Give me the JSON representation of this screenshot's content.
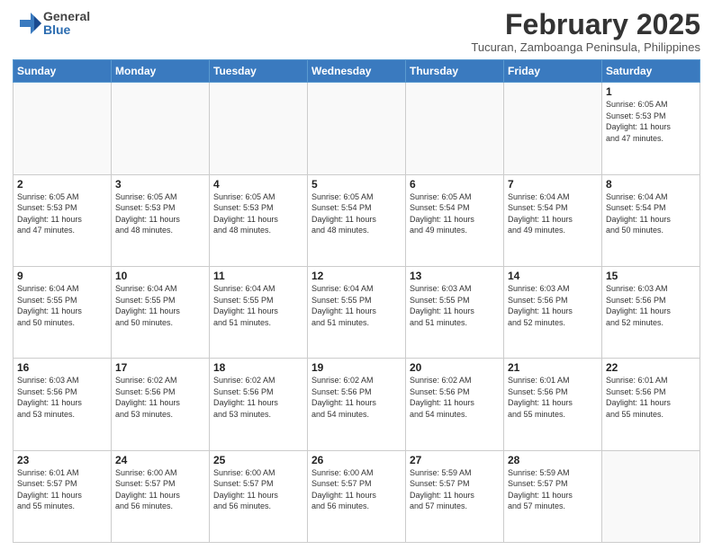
{
  "header": {
    "logo_general": "General",
    "logo_blue": "Blue",
    "month_title": "February 2025",
    "subtitle": "Tucuran, Zamboanga Peninsula, Philippines"
  },
  "weekdays": [
    "Sunday",
    "Monday",
    "Tuesday",
    "Wednesday",
    "Thursday",
    "Friday",
    "Saturday"
  ],
  "weeks": [
    [
      {
        "day": "",
        "info": ""
      },
      {
        "day": "",
        "info": ""
      },
      {
        "day": "",
        "info": ""
      },
      {
        "day": "",
        "info": ""
      },
      {
        "day": "",
        "info": ""
      },
      {
        "day": "",
        "info": ""
      },
      {
        "day": "1",
        "info": "Sunrise: 6:05 AM\nSunset: 5:53 PM\nDaylight: 11 hours\nand 47 minutes."
      }
    ],
    [
      {
        "day": "2",
        "info": "Sunrise: 6:05 AM\nSunset: 5:53 PM\nDaylight: 11 hours\nand 47 minutes."
      },
      {
        "day": "3",
        "info": "Sunrise: 6:05 AM\nSunset: 5:53 PM\nDaylight: 11 hours\nand 48 minutes."
      },
      {
        "day": "4",
        "info": "Sunrise: 6:05 AM\nSunset: 5:53 PM\nDaylight: 11 hours\nand 48 minutes."
      },
      {
        "day": "5",
        "info": "Sunrise: 6:05 AM\nSunset: 5:54 PM\nDaylight: 11 hours\nand 48 minutes."
      },
      {
        "day": "6",
        "info": "Sunrise: 6:05 AM\nSunset: 5:54 PM\nDaylight: 11 hours\nand 49 minutes."
      },
      {
        "day": "7",
        "info": "Sunrise: 6:04 AM\nSunset: 5:54 PM\nDaylight: 11 hours\nand 49 minutes."
      },
      {
        "day": "8",
        "info": "Sunrise: 6:04 AM\nSunset: 5:54 PM\nDaylight: 11 hours\nand 50 minutes."
      }
    ],
    [
      {
        "day": "9",
        "info": "Sunrise: 6:04 AM\nSunset: 5:55 PM\nDaylight: 11 hours\nand 50 minutes."
      },
      {
        "day": "10",
        "info": "Sunrise: 6:04 AM\nSunset: 5:55 PM\nDaylight: 11 hours\nand 50 minutes."
      },
      {
        "day": "11",
        "info": "Sunrise: 6:04 AM\nSunset: 5:55 PM\nDaylight: 11 hours\nand 51 minutes."
      },
      {
        "day": "12",
        "info": "Sunrise: 6:04 AM\nSunset: 5:55 PM\nDaylight: 11 hours\nand 51 minutes."
      },
      {
        "day": "13",
        "info": "Sunrise: 6:03 AM\nSunset: 5:55 PM\nDaylight: 11 hours\nand 51 minutes."
      },
      {
        "day": "14",
        "info": "Sunrise: 6:03 AM\nSunset: 5:56 PM\nDaylight: 11 hours\nand 52 minutes."
      },
      {
        "day": "15",
        "info": "Sunrise: 6:03 AM\nSunset: 5:56 PM\nDaylight: 11 hours\nand 52 minutes."
      }
    ],
    [
      {
        "day": "16",
        "info": "Sunrise: 6:03 AM\nSunset: 5:56 PM\nDaylight: 11 hours\nand 53 minutes."
      },
      {
        "day": "17",
        "info": "Sunrise: 6:02 AM\nSunset: 5:56 PM\nDaylight: 11 hours\nand 53 minutes."
      },
      {
        "day": "18",
        "info": "Sunrise: 6:02 AM\nSunset: 5:56 PM\nDaylight: 11 hours\nand 53 minutes."
      },
      {
        "day": "19",
        "info": "Sunrise: 6:02 AM\nSunset: 5:56 PM\nDaylight: 11 hours\nand 54 minutes."
      },
      {
        "day": "20",
        "info": "Sunrise: 6:02 AM\nSunset: 5:56 PM\nDaylight: 11 hours\nand 54 minutes."
      },
      {
        "day": "21",
        "info": "Sunrise: 6:01 AM\nSunset: 5:56 PM\nDaylight: 11 hours\nand 55 minutes."
      },
      {
        "day": "22",
        "info": "Sunrise: 6:01 AM\nSunset: 5:56 PM\nDaylight: 11 hours\nand 55 minutes."
      }
    ],
    [
      {
        "day": "23",
        "info": "Sunrise: 6:01 AM\nSunset: 5:57 PM\nDaylight: 11 hours\nand 55 minutes."
      },
      {
        "day": "24",
        "info": "Sunrise: 6:00 AM\nSunset: 5:57 PM\nDaylight: 11 hours\nand 56 minutes."
      },
      {
        "day": "25",
        "info": "Sunrise: 6:00 AM\nSunset: 5:57 PM\nDaylight: 11 hours\nand 56 minutes."
      },
      {
        "day": "26",
        "info": "Sunrise: 6:00 AM\nSunset: 5:57 PM\nDaylight: 11 hours\nand 56 minutes."
      },
      {
        "day": "27",
        "info": "Sunrise: 5:59 AM\nSunset: 5:57 PM\nDaylight: 11 hours\nand 57 minutes."
      },
      {
        "day": "28",
        "info": "Sunrise: 5:59 AM\nSunset: 5:57 PM\nDaylight: 11 hours\nand 57 minutes."
      },
      {
        "day": "",
        "info": ""
      }
    ]
  ]
}
